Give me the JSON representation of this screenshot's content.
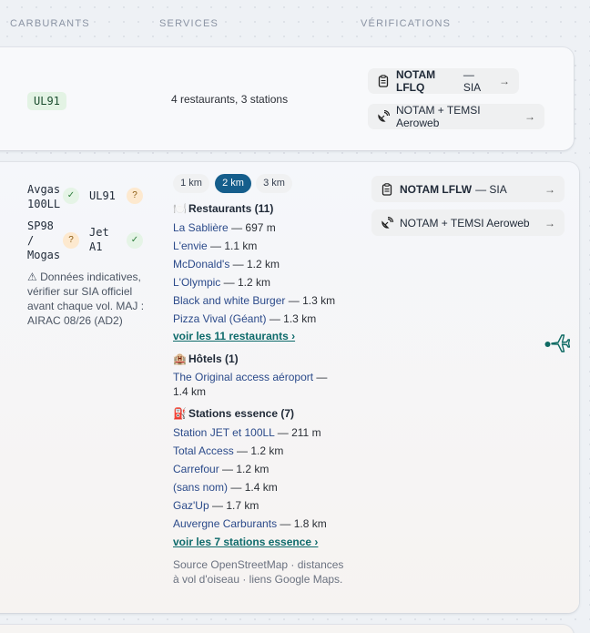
{
  "headers": {
    "fuels": "CARBURANTS",
    "services": "SERVICES",
    "checks": "VÉRIFICATIONS"
  },
  "row1": {
    "fuel": "UL91",
    "services_summary": "4 restaurants, 3 stations",
    "notam": {
      "code": "NOTAM LFLQ",
      "suffix": "— SIA",
      "arrow": "→"
    },
    "temsi": {
      "label": "NOTAM + TEMSI Aeroweb",
      "arrow": "→"
    }
  },
  "row2": {
    "fuels": [
      {
        "code": "Avgas 100LL",
        "status": "✓"
      },
      {
        "code": "UL91",
        "status": "?"
      },
      {
        "code": "SP98 / Mogas",
        "status": "?"
      },
      {
        "code": "Jet A1",
        "status": "✓"
      }
    ],
    "disclaimer": "⚠ Données indicatives, vérifier sur SIA officiel avant chaque vol. MAJ : AIRAC 08/26 (AD2)",
    "radius_tabs": [
      "1 km",
      "2 km",
      "3 km"
    ],
    "active_radius": "2 km",
    "restaurants": {
      "title": "Restaurants (11)",
      "emoji": "🍽️",
      "items": [
        {
          "name": "La Sablière",
          "dist": "— 697 m"
        },
        {
          "name": "L'envie",
          "dist": "— 1.1 km"
        },
        {
          "name": "McDonald's",
          "dist": "— 1.2 km"
        },
        {
          "name": "L'Olympic",
          "dist": "— 1.2 km"
        },
        {
          "name": "Black and white Burger",
          "dist": "— 1.3 km"
        },
        {
          "name": "Pizza Vival (Géant)",
          "dist": "— 1.3 km"
        }
      ],
      "more": "voir les 11 restaurants ›"
    },
    "hotels": {
      "title": "Hôtels (1)",
      "emoji": "🏨",
      "items": [
        {
          "name": "The Original access aéroport",
          "dist": "— 1.4 km"
        }
      ]
    },
    "stations": {
      "title": "Stations essence (7)",
      "emoji": "⛽",
      "items": [
        {
          "name": "Station JET et 100LL",
          "dist": "— 211 m"
        },
        {
          "name": "Total Access",
          "dist": "— 1.2 km"
        },
        {
          "name": "Carrefour",
          "dist": "— 1.2 km"
        },
        {
          "name": "(sans nom)",
          "dist": "— 1.4 km"
        },
        {
          "name": "Gaz'Up",
          "dist": "— 1.7 km"
        },
        {
          "name": "Auvergne Carburants",
          "dist": "— 1.8 km"
        }
      ],
      "more": "voir les 7 stations essence ›"
    },
    "source": "Source OpenStreetMap · distances à vol d'oiseau · liens Google Maps.",
    "notam": {
      "code": "NOTAM LFLW",
      "suffix": "— SIA",
      "arrow": "→"
    },
    "temsi": {
      "label": "NOTAM + TEMSI Aeroweb",
      "arrow": "→"
    }
  },
  "colors": {
    "accent": "#155e8c",
    "link": "#2b4a8a",
    "more_link": "#0e6b6b",
    "ok_badge": "#e5f4e6",
    "warn_badge": "#fde9cf"
  }
}
